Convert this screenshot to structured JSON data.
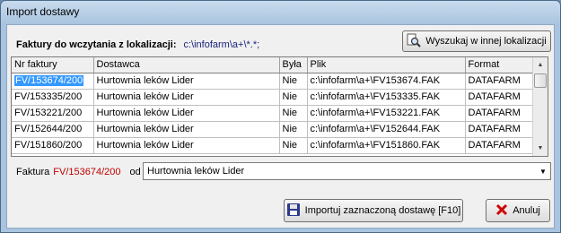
{
  "window": {
    "title": "Import dostawy"
  },
  "heading": {
    "label": "Faktury do wczytania z lokalizacji:",
    "path": "c:\\infofarm\\a+\\*.*;"
  },
  "search_button": {
    "label": "Wyszukaj w innej lokalizacji",
    "icon": "magnifier-document-icon"
  },
  "table": {
    "columns": [
      "Nr faktury",
      "Dostawca",
      "Była",
      "Plik",
      "Format"
    ],
    "rows": [
      [
        "FV/153674/200",
        "Hurtownia leków Lider",
        "Nie",
        "c:\\infofarm\\a+\\FV153674.FAK",
        "DATAFARM"
      ],
      [
        "FV/153335/200",
        "Hurtownia leków Lider",
        "Nie",
        "c:\\infofarm\\a+\\FV153335.FAK",
        "DATAFARM"
      ],
      [
        "FV/153221/200",
        "Hurtownia leków Lider",
        "Nie",
        "c:\\infofarm\\a+\\FV153221.FAK",
        "DATAFARM"
      ],
      [
        "FV/152644/200",
        "Hurtownia leków Lider",
        "Nie",
        "c:\\infofarm\\a+\\FV152644.FAK",
        "DATAFARM"
      ],
      [
        "FV/151860/200",
        "Hurtownia leków Lider",
        "Nie",
        "c:\\infofarm\\a+\\FV151860.FAK",
        "DATAFARM"
      ]
    ],
    "selected_row": 0
  },
  "faktura": {
    "label": "Faktura",
    "number": "FV/153674/200",
    "od_label": "od",
    "supplier": "Hurtownia leków Lider"
  },
  "import_button": {
    "label": "Importuj zaznaczoną dostawę [F10]",
    "icon": "floppy-disk-icon"
  },
  "cancel_button": {
    "label": "Anuluj",
    "icon": "red-x-icon"
  },
  "colors": {
    "selection": "#3399ff",
    "invoice_number": "#c00000",
    "path_text": "#1a237e"
  }
}
